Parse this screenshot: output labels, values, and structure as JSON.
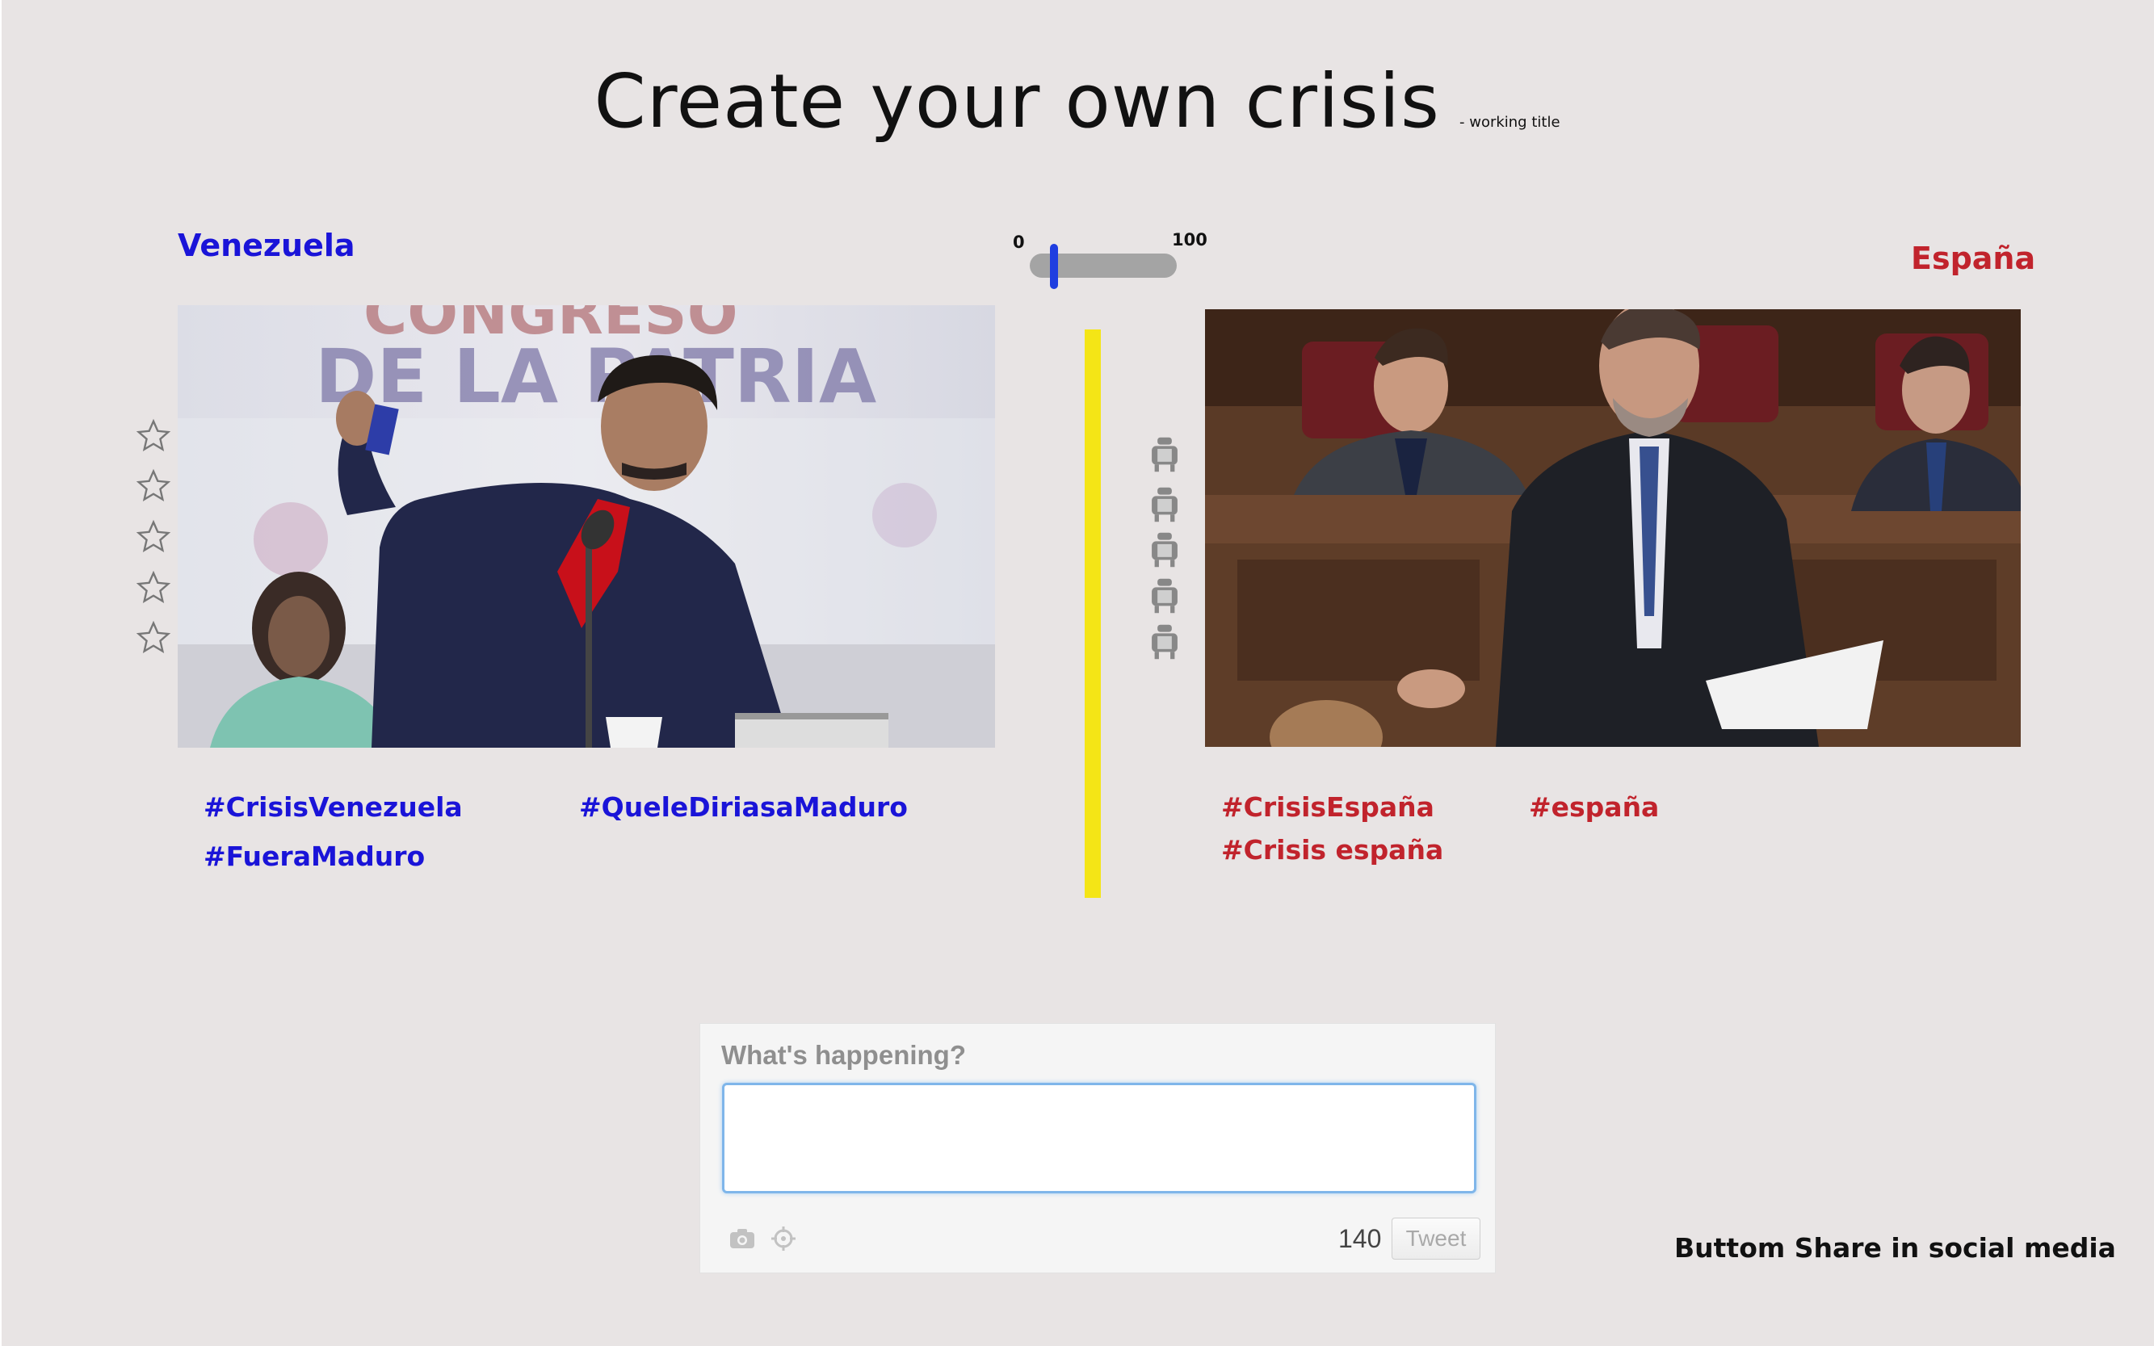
{
  "header": {
    "title": "Create your own crisis",
    "subtitle": "- working title"
  },
  "left_panel": {
    "country": "Venezuela",
    "country_color": "#1a14d8",
    "rating_stars": 5,
    "hashtags": [
      "#CrisisVenezuela",
      "#QueleDiriasaMaduro",
      "#FueraMaduro"
    ]
  },
  "right_panel": {
    "country": "España",
    "country_color": "#c1232c",
    "seat_icons": 5,
    "hashtags": [
      "#CrisisEspaña",
      "#españa",
      "#Crisis españa"
    ]
  },
  "slider": {
    "min_label": "0",
    "max_label": "100",
    "value_fraction": 0.1,
    "thumb_color": "#1f3ee0"
  },
  "divider_color": "#f4e516",
  "tweet": {
    "prompt": "What's happening?",
    "value": "",
    "char_count": "140",
    "button_label": "Tweet"
  },
  "share_note": "Buttom Share in social media"
}
